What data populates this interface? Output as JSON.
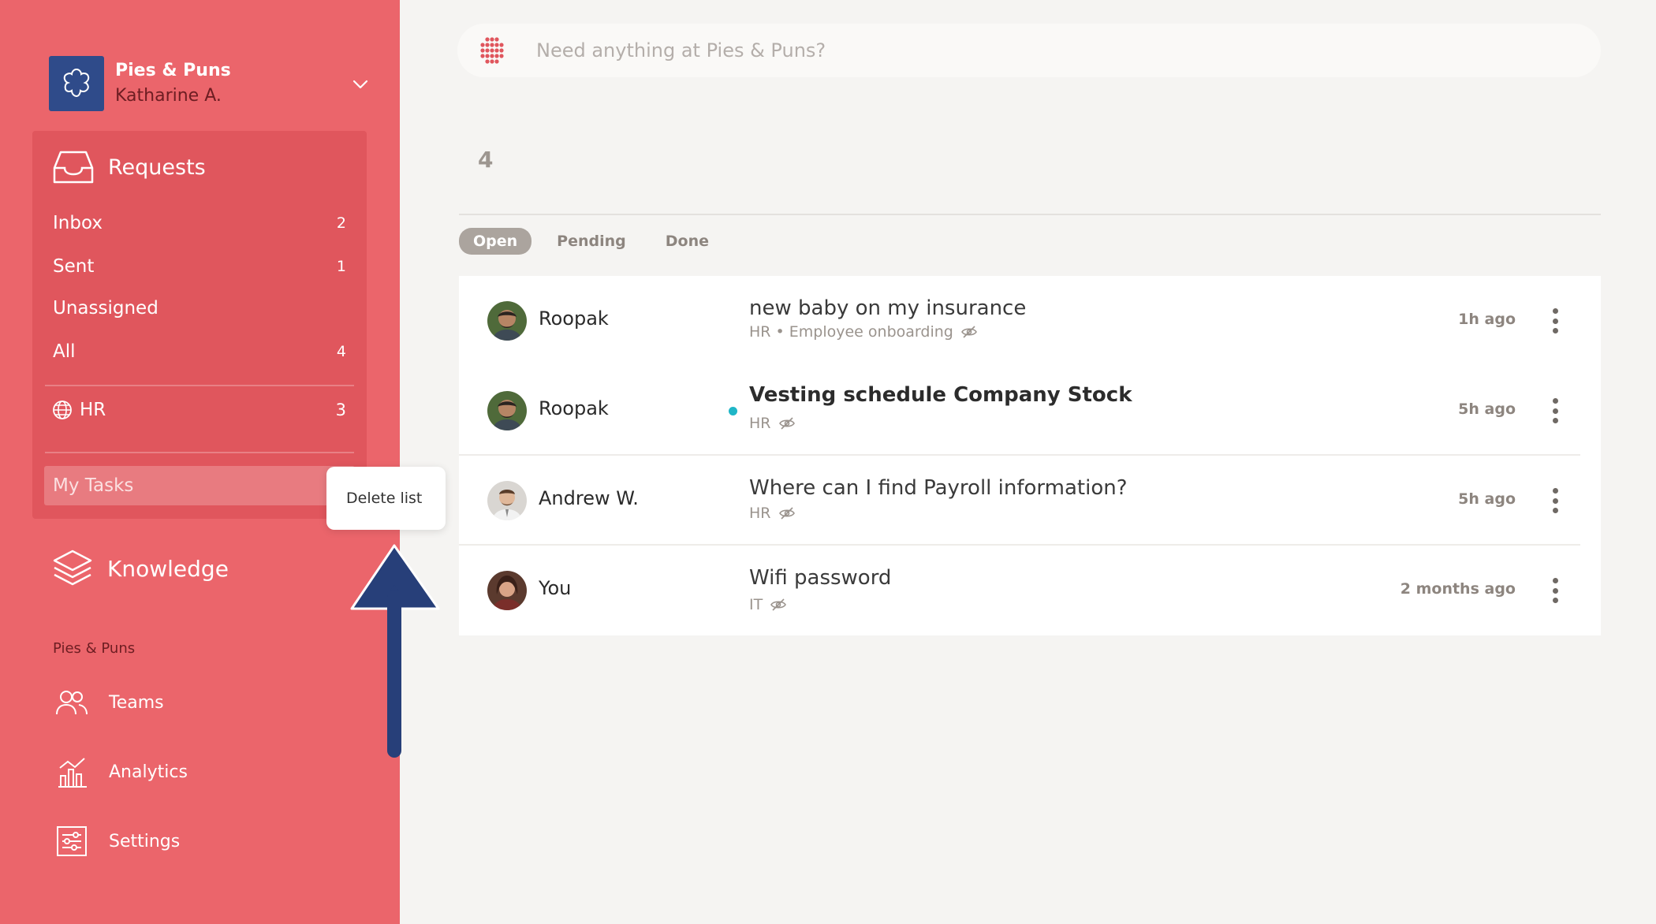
{
  "colors": {
    "sidebar": "#eb656b",
    "panel": "#e0565d",
    "accent_dark": "#6d1d22",
    "arrow": "#273f79",
    "unread": "#1fb6c7"
  },
  "org": {
    "name": "Pies & Puns",
    "user": "Katharine A.",
    "logo_icon": "flower-icon"
  },
  "requests": {
    "title": "Requests",
    "items": [
      {
        "label": "Inbox",
        "count": "2"
      },
      {
        "label": "Sent",
        "count": "1"
      },
      {
        "label": "Unassigned",
        "count": ""
      },
      {
        "label": "All",
        "count": "4"
      }
    ],
    "hr": {
      "label": "HR",
      "count": "3"
    },
    "my_tasks": "My Tasks"
  },
  "context_menu": {
    "delete_list": "Delete list"
  },
  "knowledge": {
    "title": "Knowledge"
  },
  "section_label": "Pies & Puns",
  "nav": [
    {
      "label": "Teams",
      "icon": "people-icon"
    },
    {
      "label": "Analytics",
      "icon": "analytics-icon"
    },
    {
      "label": "Settings",
      "icon": "sliders-icon"
    }
  ],
  "search": {
    "placeholder": "Need anything at Pies & Puns?"
  },
  "total_count": "4",
  "tabs": [
    "Open",
    "Pending",
    "Done"
  ],
  "active_tab": "Open",
  "requests_list": [
    {
      "user": "Roopak",
      "subject": "new baby on my insurance",
      "meta": "HR • Employee onboarding",
      "time": "1h ago",
      "unread": false
    },
    {
      "user": "Roopak",
      "subject": "Vesting schedule Company Stock",
      "meta": "HR",
      "time": "5h ago",
      "unread": true
    },
    {
      "user": "Andrew W.",
      "subject": "Where can I find Payroll information?",
      "meta": "HR",
      "time": "5h ago",
      "unread": false
    },
    {
      "user": "You",
      "subject": "Wifi password",
      "meta": "IT",
      "time": "2 months ago",
      "unread": false
    }
  ]
}
